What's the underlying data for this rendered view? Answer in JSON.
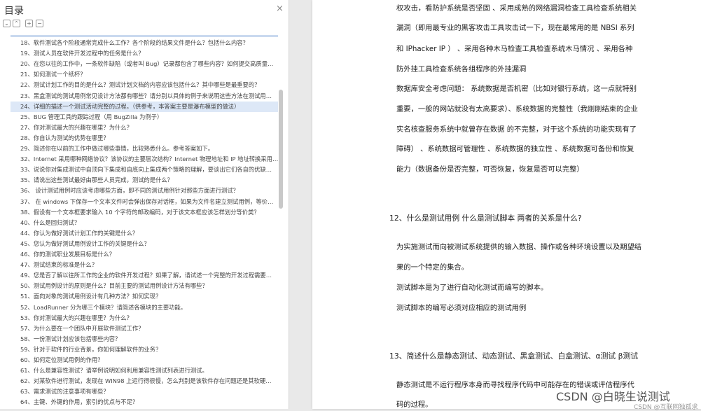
{
  "toc": {
    "title": "目录",
    "close_icon": "×",
    "tools": [
      {
        "name": "expand-all-icon",
        "glyph": "⌄"
      },
      {
        "name": "collapse-all-icon",
        "glyph": "⌃"
      },
      {
        "name": "add-bookmark-icon",
        "glyph": "+"
      },
      {
        "name": "remove-bookmark-icon",
        "glyph": "−"
      }
    ],
    "items": [
      "18、软件测试各个阶段通常完成什么工作？各个阶段的结果文件是什么？包括什么内容？",
      "19、测试人员在软件开发过程中的任务是什么？",
      "20、在您以往的工作中，一条软件缺陷（或者叫 Bug）记录都包含了哪些内容？如何提交高质量…",
      "21、如何测试一个纸杯？",
      "22、测试计划工作的目的是什么？测试计划文档的内容应该包括什么？其中哪些是最重要的？",
      "23、黑盒测试的测试用例常见设计方法都有哪些？请分别以具体的例子来说明这些方法在测试用…",
      "24、详细的描述一个测试活动完整的过程。（供参考，本答案主要是瀑布模型的做法）",
      "25、BUG 管理工具的跟踪过程（用 BugZilla 为例子）",
      "27、你对测试最大的兴趣在哪里？为什么？",
      "28、你自认为测试的优势在哪里？",
      "29、简述你在以前的工作中做过哪些事情，比较熟悉什么。参考答案如下。",
      "32、Internet 采用哪种网络协议？该协议的主要层次结构？Internet 物理地址和 IP 地址转换采用…",
      "33、说说你对集成测试中自顶向下集成和自底向上集成两个策略的理解，要谈出它们各自的优缺…",
      "35、请说出这些测试最好由那些人员完成，测试的是什么？",
      "36、 设计测试用例时应该考虑哪些方面，即不同的测试用例针对那些方面进行测试？",
      "37、 在 windows 下保存一个文本文件时会弹出保存对话框，如果为文件名建立测试用例，等价…",
      "38、假设有一个文本框要求输入 10 个字符的邮政编码，对于该文本框应该怎样划分等价类？",
      "40、什么是回归测试？",
      "44、你认为做好测试计划工作的关键是什么？",
      "45、您认为做好测试用例设计工作的关键是什么？",
      "46、你的测试职业发展目标是什么？",
      "47、测试结束的标准是什么？",
      "49、您是否了解以往所工作的企业的软件开发过程？如果了解，请试述一个完整的开发过程需要…",
      "50、测试用例设计的原则是什么？目前主要的测试用例设计方法有哪些？",
      "51、面向对象的测试用例设计有几种方法？如何实现？",
      "52、LoadRunner 分为哪三个模块？请简述各模块的主要功能。",
      "53、你对测试最大的兴趣在哪里？为什么？",
      "57、为什么要在一个团队中开展软件测试工作？",
      "58、一份测试计划应该包括哪些内容？",
      "59、针对于软件的行业背景，你如何理解软件的业务？",
      "60、如何定位测试用例的作用？",
      "61、什么是兼容性测试？请举例说明如何利用兼容性测试列表进行测试。",
      "62、对某软件进行测试，发现在 WIN98 上运行得很慢，怎么判别是该软件存在问题还是其软硬…",
      "63、需求测试的注意事项有哪些？",
      "64、主键、外键的作用，索引的优点与不足？"
    ],
    "active_index": 6
  },
  "doc": {
    "para_top": [
      "权攻击，看防护系统是否坚固 、采用成熟的网络漏洞检查工具检查系统相关",
      "漏洞（即用最专业的黑客攻击工具攻击试一下，现在最常用的是  NBSI 系列",
      "和  IPhacker IP  ）  、采用各种木马检查工具检查系统木马情况  、采用各种",
      "防外挂工具检查系统各组程序的外挂漏洞",
      "数据库安全考虑问题：  系统数据是否机密（比如对银行系统，这一点就特别",
      "重要，一般的网站就没有太高要求）、系统数据的完整性（我刚刚结束的企业",
      "实名核查服务系统中就曾存在数据  的不完整，对于这个系统的功能实现有了",
      "障碍）  、系统数据可管理性  、系统数据的独立性  、系统数据可备份和恢复",
      "能力（数据备份是否完整，可否恢复，恢复是否可以完整）"
    ],
    "q12_heading": "12、什么是测试用例 什么是测试脚本 两者的关系是什么?",
    "q12_body": [
      "为实施测试而向被测试系统提供的输入数据、操作或各种环境设置以及期望结",
      "果的一个特定的集合。",
      "测试脚本是为了进行自动化测试而编写的脚本。",
      "测试脚本的编写必须对应相应的测试用例"
    ],
    "q13_heading": "13、简述什么是静态测试、动态测试、黑盒测试、白盒测试、α测试 β测试",
    "q13_body": [
      "静态测试是不运行程序本身而寻找程序代码中可能存在的错误或评估程序代",
      "码的过程。"
    ]
  },
  "watermark": "CSDN @白晓生说测试",
  "watermark2": "CSDN @互联网独孤求"
}
